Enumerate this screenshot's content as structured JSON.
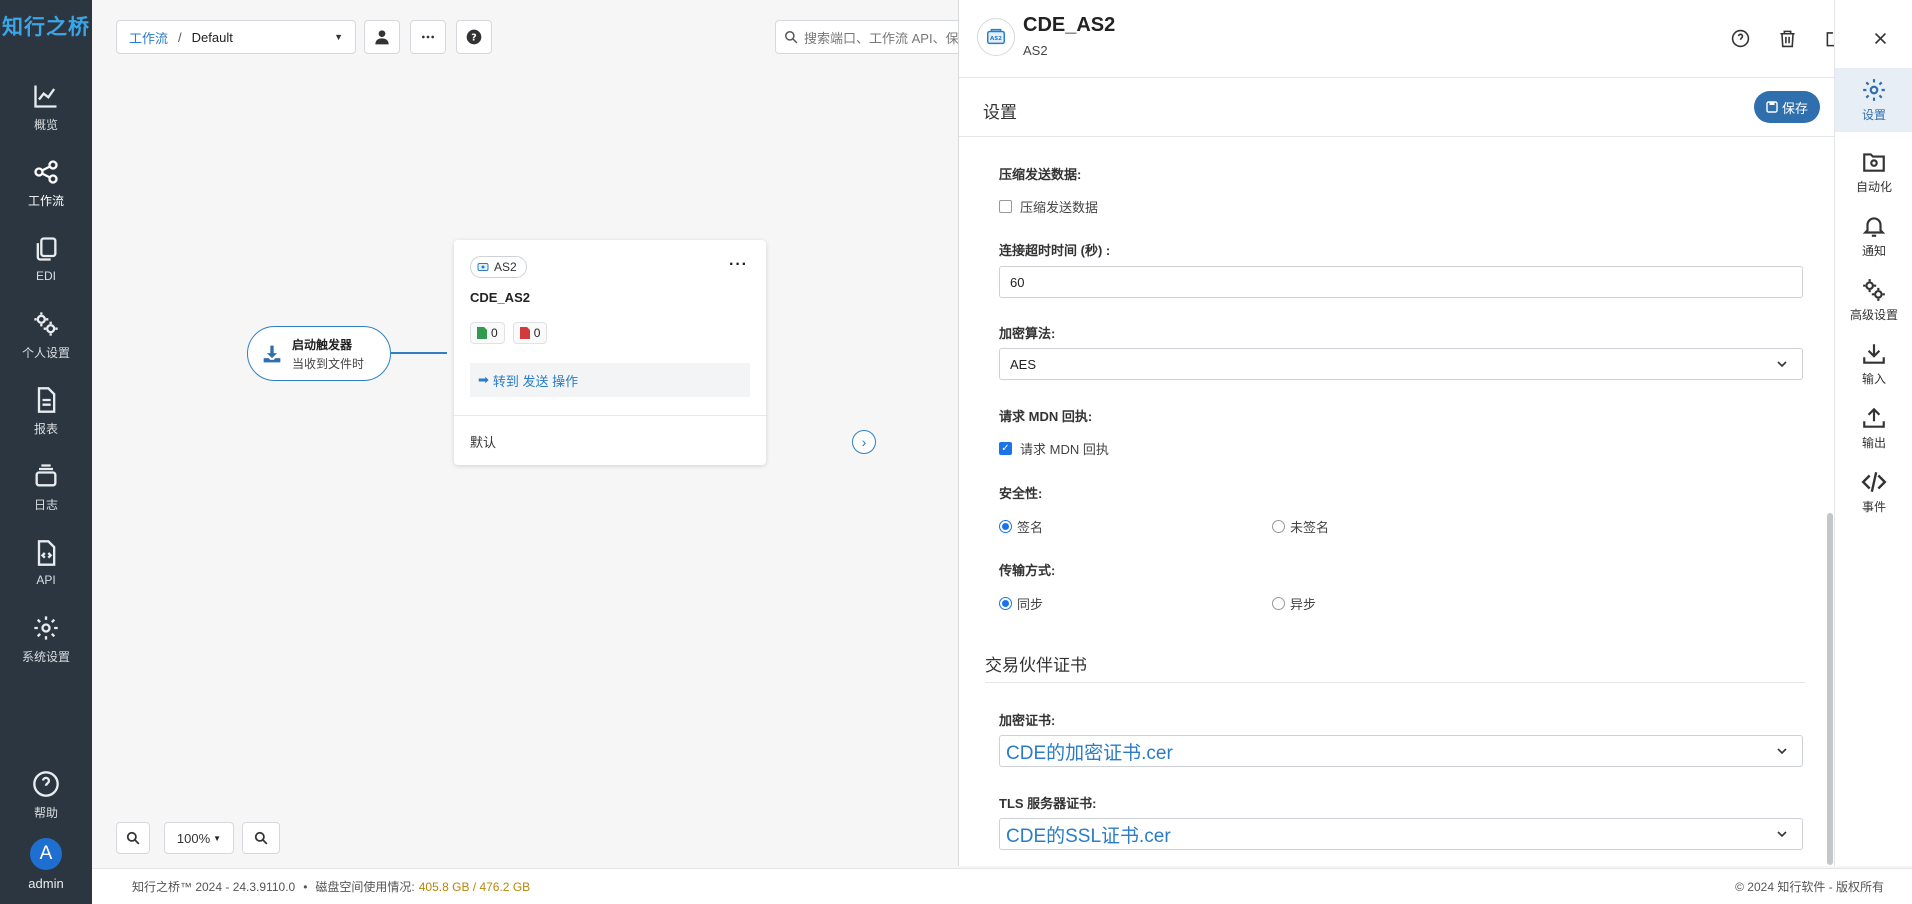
{
  "brand": "知行之桥",
  "nav": [
    {
      "label": "概览",
      "icon": "chart-line-icon"
    },
    {
      "label": "工作流",
      "icon": "share-nodes-icon"
    },
    {
      "label": "EDI",
      "icon": "copy-icon"
    },
    {
      "label": "个人设置",
      "icon": "gears-icon"
    },
    {
      "label": "报表",
      "icon": "file-lines-icon"
    },
    {
      "label": "日志",
      "icon": "layers-icon"
    },
    {
      "label": "API",
      "icon": "file-code-icon"
    },
    {
      "label": "系统设置",
      "icon": "gear-icon"
    },
    {
      "label": "帮助",
      "icon": "help-icon"
    }
  ],
  "user": {
    "initial": "A",
    "name": "admin"
  },
  "toolbar": {
    "breadcrumb_link": "工作流",
    "breadcrumb_sep": "/",
    "breadcrumb_current": "Default",
    "search_placeholder": "搜索端口、工作流 API、保"
  },
  "trigger": {
    "title": "启动触发器",
    "subtitle": "当收到文件时"
  },
  "card": {
    "chip": "AS2",
    "title": "CDE_AS2",
    "count_ok": "0",
    "count_err": "0",
    "goto": "转到 发送 操作",
    "default": "默认"
  },
  "zoom": {
    "level": "100%"
  },
  "footer": {
    "version": "知行之桥™ 2024 - 24.3.9110.0",
    "dot": "•",
    "disk_label": "磁盘空间使用情况:",
    "disk_value": "405.8 GB / 476.2 GB",
    "copyright": "© 2024 知行软件 - 版权所有"
  },
  "panel": {
    "title": "CDE_AS2",
    "subtitle": "AS2",
    "settings_title": "设置",
    "save_label": "保存"
  },
  "form": {
    "compress_label": "压缩发送数据:",
    "compress_check": "压缩发送数据",
    "compress_checked": false,
    "timeout_label": "连接超时时间 (秒) :",
    "timeout_value": "60",
    "encrypt_label": "加密算法:",
    "encrypt_value": "AES",
    "mdn_label": "请求 MDN 回执:",
    "mdn_check": "请求 MDN 回执",
    "mdn_checked": true,
    "security_label": "安全性:",
    "security_options": [
      "签名",
      "未签名"
    ],
    "security_selected": "签名",
    "transfer_label": "传输方式:",
    "transfer_options": [
      "同步",
      "异步"
    ],
    "transfer_selected": "同步",
    "cert_section": "交易伙伴证书",
    "enc_cert_label": "加密证书:",
    "enc_cert_value": "CDE的加密证书.cer",
    "tls_cert_label": "TLS 服务器证书:",
    "tls_cert_value": "CDE的SSL证书.cer"
  },
  "rail": [
    {
      "label": "设置",
      "icon": "gear-icon",
      "active": true
    },
    {
      "label": "自动化",
      "icon": "folder-gear-icon"
    },
    {
      "label": "通知",
      "icon": "bell-icon"
    },
    {
      "label": "高级设置",
      "icon": "gears-icon"
    },
    {
      "label": "输入",
      "icon": "download-icon"
    },
    {
      "label": "输出",
      "icon": "upload-icon"
    },
    {
      "label": "事件",
      "icon": "code-icon"
    }
  ],
  "colors": {
    "accent": "#2f6fad",
    "link": "#2a7cc7",
    "nav_bg": "#2b3640",
    "disk": "#b8860b"
  }
}
